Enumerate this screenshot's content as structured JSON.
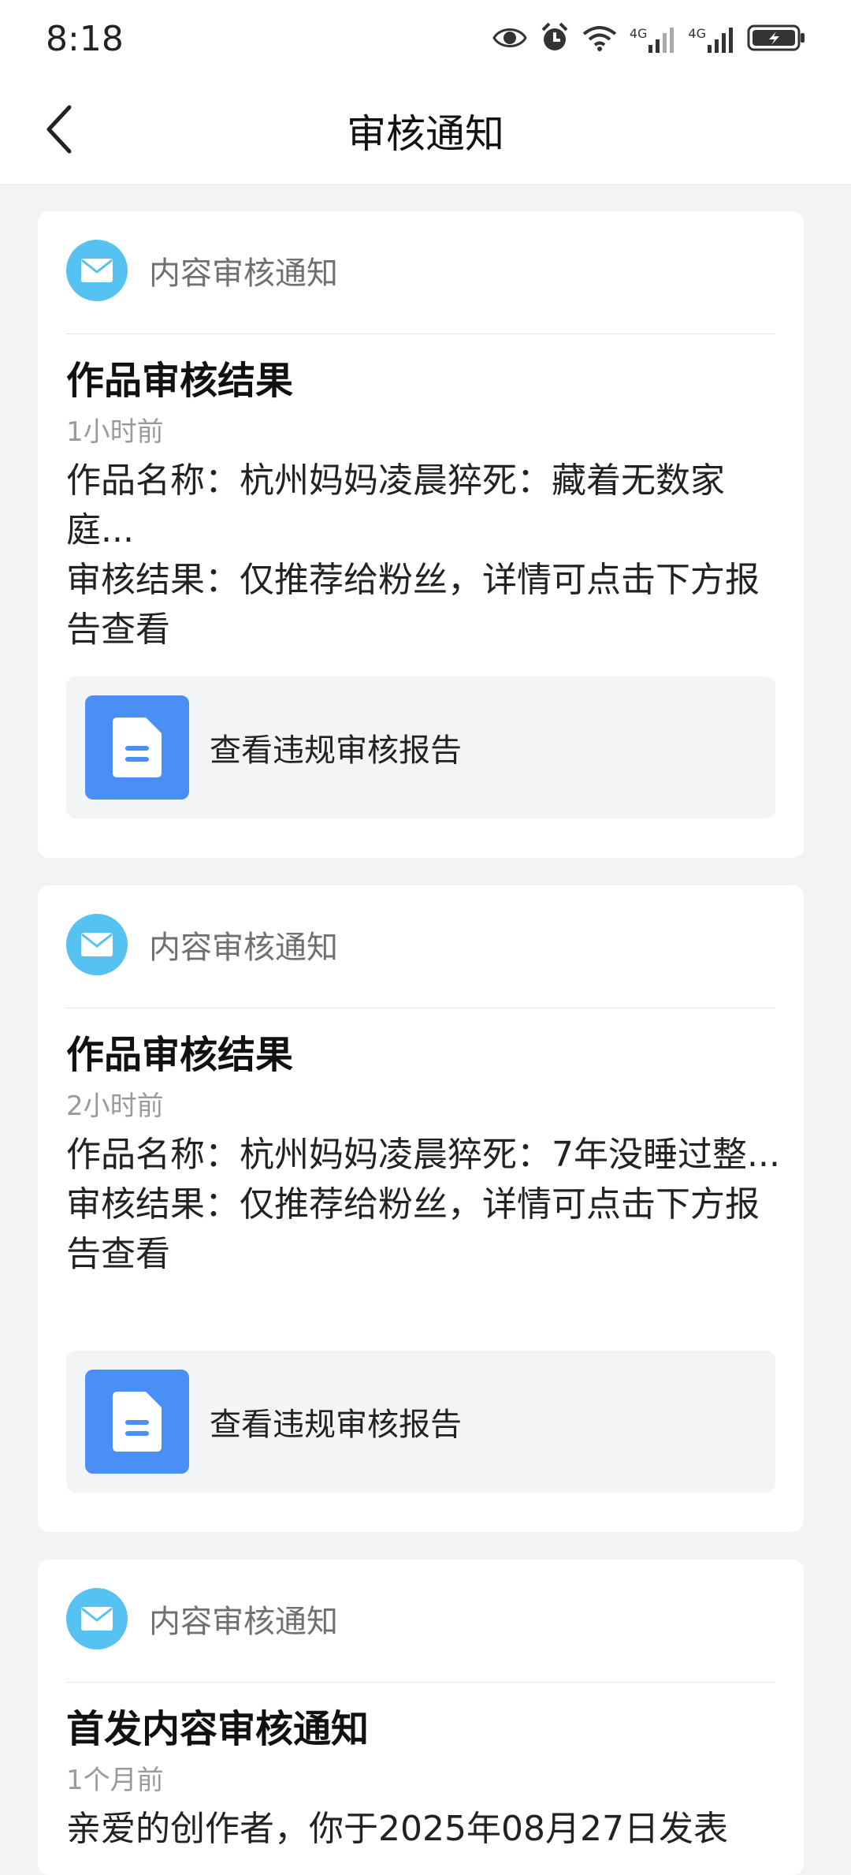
{
  "status_bar": {
    "time": "8:18",
    "icons": [
      "eye-icon",
      "alarm-icon",
      "wifi-icon",
      "signal-4g-icon",
      "signal-4g-icon",
      "battery-charging-icon"
    ],
    "signal_label_1": "4G",
    "signal_label_2": "4G"
  },
  "nav": {
    "title": "审核通知",
    "back_icon": "chevron-left-icon"
  },
  "cards": [
    {
      "source": "内容审核通知",
      "title": "作品审核结果",
      "time": "1小时前",
      "work_name": "作品名称：杭州妈妈凌晨猝死：藏着无数家庭...",
      "result": "审核结果：仅推荐给粉丝，详情可点击下方报告查看",
      "report_label": "查看违规审核报告"
    },
    {
      "source": "内容审核通知",
      "title": "作品审核结果",
      "time": "2小时前",
      "work_name": "作品名称：杭州妈妈凌晨猝死：7年没睡过整...",
      "result": "审核结果：仅推荐给粉丝，详情可点击下方报告查看",
      "report_label": "查看违规审核报告"
    },
    {
      "source": "内容审核通知",
      "title": "首发内容审核通知",
      "time": "1个月前",
      "body": "亲爱的创作者，你于2025年08月27日发表"
    }
  ],
  "colors": {
    "background": "#f2f3f5",
    "card": "#ffffff",
    "mail_icon_bg": "#55c2f1",
    "doc_tile": "#4a8ff5",
    "report_box": "#f3f4f6"
  }
}
